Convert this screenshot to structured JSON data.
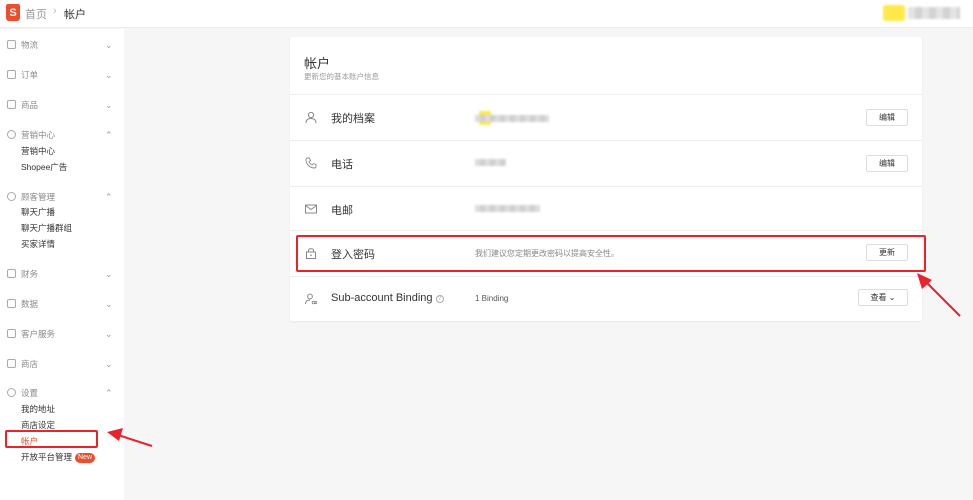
{
  "header": {
    "logo_letter": "S",
    "breadcrumb_home": "首页",
    "breadcrumb_sep": "›",
    "breadcrumb_current": "帐户"
  },
  "sidebar": {
    "menus": [
      {
        "label": "物流",
        "icon": "box-icon",
        "chevron": "⌄"
      },
      {
        "label": "订单",
        "icon": "clipboard-icon",
        "chevron": "⌄"
      },
      {
        "label": "商品",
        "icon": "bag-icon",
        "chevron": "⌄"
      },
      {
        "label": "营销中心",
        "icon": "tag-icon",
        "chevron": "⌃",
        "subs": [
          "营销中心",
          "Shopee广告"
        ]
      },
      {
        "label": "顾客管理",
        "icon": "users-icon",
        "chevron": "⌃",
        "subs": [
          "聊天广播",
          "聊天广播群组",
          "买家详情"
        ]
      },
      {
        "label": "财务",
        "icon": "wallet-icon",
        "chevron": "⌄"
      },
      {
        "label": "数据",
        "icon": "chart-icon",
        "chevron": "⌄"
      },
      {
        "label": "客户服务",
        "icon": "chat-icon",
        "chevron": "⌄"
      },
      {
        "label": "商店",
        "icon": "store-icon",
        "chevron": "⌄"
      },
      {
        "label": "设置",
        "icon": "gear-icon",
        "chevron": "⌃",
        "subs": [
          "我的地址",
          "商店设定",
          "帐户",
          "开放平台管理"
        ]
      }
    ],
    "new_badge": "New"
  },
  "card": {
    "title": "帐户",
    "subtitle": "更新您的基本账户信息",
    "rows": {
      "profile": {
        "label": "我的档案",
        "button": "编辑"
      },
      "phone": {
        "label": "电话",
        "button": "编辑"
      },
      "email": {
        "label": "电邮"
      },
      "password": {
        "label": "登入密码",
        "value": "我们建议您定期更改密码以提高安全性。",
        "button": "更新"
      },
      "subaccount": {
        "label": "Sub-account Binding",
        "value": "1 Binding",
        "button": "查看",
        "button_chevron": "⌄"
      }
    }
  },
  "colors": {
    "brand": "#ee4d2d",
    "annotation_red": "#e8232c"
  }
}
